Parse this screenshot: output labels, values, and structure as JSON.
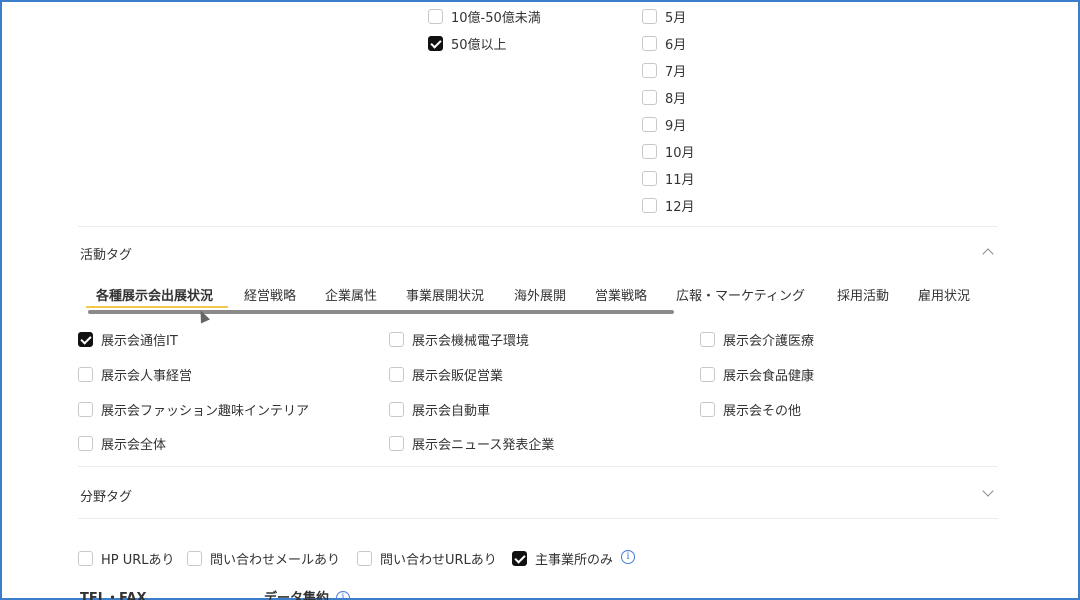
{
  "revenue_options": [
    {
      "label": "10億-50億未満",
      "checked": false
    },
    {
      "label": "50億以上",
      "checked": true
    }
  ],
  "month_options": [
    {
      "label": "5月",
      "checked": false
    },
    {
      "label": "6月",
      "checked": false
    },
    {
      "label": "7月",
      "checked": false
    },
    {
      "label": "8月",
      "checked": false
    },
    {
      "label": "9月",
      "checked": false
    },
    {
      "label": "10月",
      "checked": false
    },
    {
      "label": "11月",
      "checked": false
    },
    {
      "label": "12月",
      "checked": false
    }
  ],
  "activity_tags": {
    "title": "活動タグ",
    "tabs": [
      {
        "label": "各種展示会出展状況",
        "active": true
      },
      {
        "label": "経営戦略",
        "active": false
      },
      {
        "label": "企業属性",
        "active": false
      },
      {
        "label": "事業展開状況",
        "active": false
      },
      {
        "label": "海外展開",
        "active": false
      },
      {
        "label": "営業戦略",
        "active": false
      },
      {
        "label": "広報・マーケティング",
        "active": false
      },
      {
        "label": "採用活動",
        "active": false
      },
      {
        "label": "雇用状況",
        "active": false
      }
    ],
    "options": [
      {
        "label": "展示会通信IT",
        "checked": true
      },
      {
        "label": "展示会機械電子環境",
        "checked": false
      },
      {
        "label": "展示会介護医療",
        "checked": false
      },
      {
        "label": "展示会人事経営",
        "checked": false
      },
      {
        "label": "展示会販促営業",
        "checked": false
      },
      {
        "label": "展示会食品健康",
        "checked": false
      },
      {
        "label": "展示会ファッション趣味インテリア",
        "checked": false
      },
      {
        "label": "展示会自動車",
        "checked": false
      },
      {
        "label": "展示会その他",
        "checked": false
      },
      {
        "label": "展示会全体",
        "checked": false
      },
      {
        "label": "展示会ニュース発表企業",
        "checked": false
      }
    ]
  },
  "field_tags": {
    "title": "分野タグ"
  },
  "filters": [
    {
      "label": "HP URLあり",
      "checked": false
    },
    {
      "label": "問い合わせメールあり",
      "checked": false
    },
    {
      "label": "問い合わせURLあり",
      "checked": false
    },
    {
      "label": "主事業所のみ",
      "checked": true
    }
  ],
  "bottom_labels": {
    "tel_fax": "TEL・FAX",
    "data_agg": "データ集約"
  }
}
